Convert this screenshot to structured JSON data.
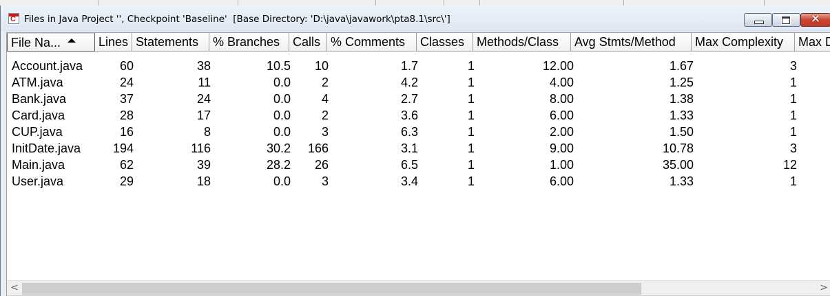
{
  "window": {
    "title": "Files in Java Project '', Checkpoint 'Baseline'  [Base Directory: 'D:\\java\\javawork\\pta8.1\\src\\']",
    "icon": "sourcemonitor-app-icon",
    "icon_letter": "C",
    "close_glyph": "✕"
  },
  "table": {
    "columns": [
      {
        "key": "file",
        "label": "File Na...",
        "sorted": true
      },
      {
        "key": "lines",
        "label": "Lines"
      },
      {
        "key": "statements",
        "label": "Statements"
      },
      {
        "key": "branches",
        "label": "% Branches"
      },
      {
        "key": "calls",
        "label": "Calls"
      },
      {
        "key": "comments",
        "label": "% Comments"
      },
      {
        "key": "classes",
        "label": "Classes"
      },
      {
        "key": "methods_class",
        "label": "Methods/Class"
      },
      {
        "key": "avg_stmts",
        "label": "Avg Stmts/Method"
      },
      {
        "key": "max_complexity",
        "label": "Max Complexity"
      },
      {
        "key": "max_depth",
        "label": "Max D"
      }
    ],
    "rows": [
      {
        "file": "Account.java",
        "lines": "60",
        "statements": "38",
        "branches": "10.5",
        "calls": "10",
        "comments": "1.7",
        "classes": "1",
        "methods_class": "12.00",
        "avg_stmts": "1.67",
        "max_complexity": "3"
      },
      {
        "file": "ATM.java",
        "lines": "24",
        "statements": "11",
        "branches": "0.0",
        "calls": "2",
        "comments": "4.2",
        "classes": "1",
        "methods_class": "4.00",
        "avg_stmts": "1.25",
        "max_complexity": "1"
      },
      {
        "file": "Bank.java",
        "lines": "37",
        "statements": "24",
        "branches": "0.0",
        "calls": "4",
        "comments": "2.7",
        "classes": "1",
        "methods_class": "8.00",
        "avg_stmts": "1.38",
        "max_complexity": "1"
      },
      {
        "file": "Card.java",
        "lines": "28",
        "statements": "17",
        "branches": "0.0",
        "calls": "2",
        "comments": "3.6",
        "classes": "1",
        "methods_class": "6.00",
        "avg_stmts": "1.33",
        "max_complexity": "1"
      },
      {
        "file": "CUP.java",
        "lines": "16",
        "statements": "8",
        "branches": "0.0",
        "calls": "3",
        "comments": "6.3",
        "classes": "1",
        "methods_class": "2.00",
        "avg_stmts": "1.50",
        "max_complexity": "1"
      },
      {
        "file": "InitDate.java",
        "lines": "194",
        "statements": "116",
        "branches": "30.2",
        "calls": "166",
        "comments": "3.1",
        "classes": "1",
        "methods_class": "9.00",
        "avg_stmts": "10.78",
        "max_complexity": "3"
      },
      {
        "file": "Main.java",
        "lines": "62",
        "statements": "39",
        "branches": "28.2",
        "calls": "26",
        "comments": "6.5",
        "classes": "1",
        "methods_class": "1.00",
        "avg_stmts": "35.00",
        "max_complexity": "12"
      },
      {
        "file": "User.java",
        "lines": "29",
        "statements": "18",
        "branches": "0.0",
        "calls": "3",
        "comments": "3.4",
        "classes": "1",
        "methods_class": "6.00",
        "avg_stmts": "1.33",
        "max_complexity": "1"
      }
    ]
  },
  "scrollbar": {
    "left_arrow": "<",
    "right_arrow": ">",
    "thumb_fraction": 0.78
  }
}
